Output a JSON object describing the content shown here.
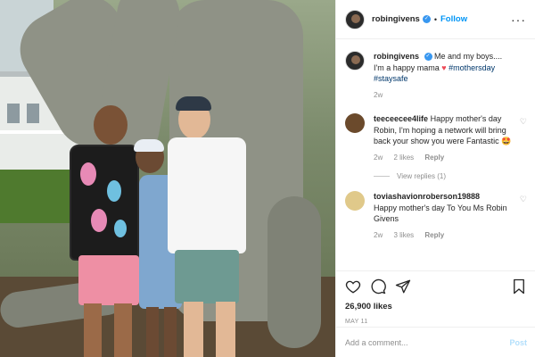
{
  "post": {
    "username": "robingivens",
    "follow_label": "Follow",
    "separator": "•",
    "more_label": "···",
    "caption_text": "Me and my boys.... I'm a happy mama ",
    "caption_heart": "♥",
    "caption_tag1": "#mothersday",
    "caption_tag2": "#staysafe",
    "caption_age": "2w"
  },
  "comments": [
    {
      "username": "teeceecee4life",
      "text": "Happy mother's day Robin, I'm hoping a network will bring back your show you were Fantastic 🤩",
      "age": "2w",
      "likes": "2 likes",
      "reply": "Reply",
      "avatar_color": "#6b4a2c"
    },
    {
      "username": "toviashavionroberson19888",
      "text": "Happy mother's day To You Ms Robin Givens",
      "age": "2w",
      "likes": "3 likes",
      "reply": "Reply",
      "avatar_color": "#e0c98a"
    }
  ],
  "view_replies_label": "View replies (1)",
  "like_count": "26,900 likes",
  "post_date": "MAY 11",
  "add_comment_placeholder": "Add a comment...",
  "post_button_label": "Post",
  "colors": {
    "accent": "#0095f6",
    "hashtag": "#00376b",
    "heart": "#ed4956",
    "muted": "#8e8e8e"
  }
}
